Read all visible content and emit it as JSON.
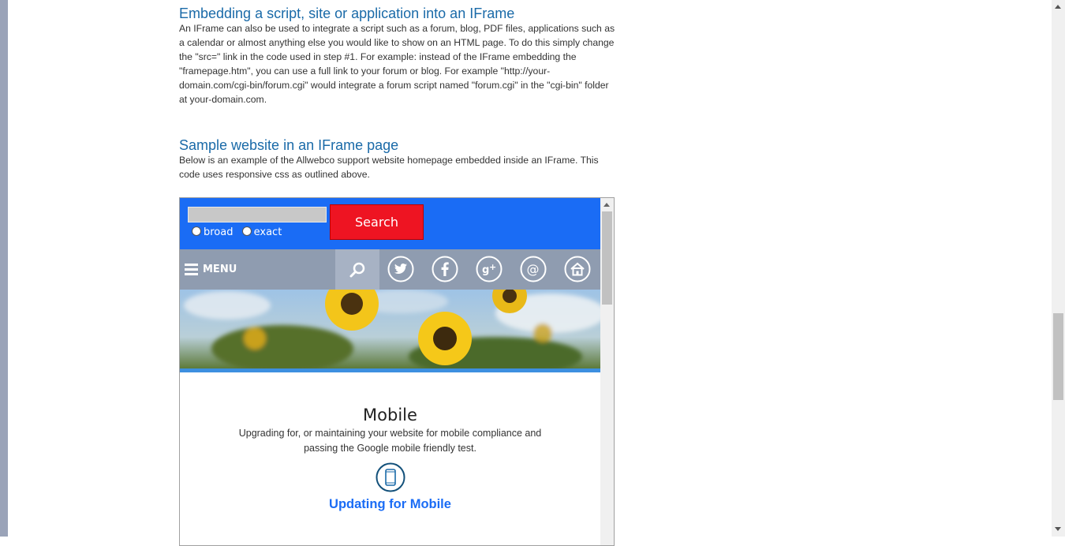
{
  "section1": {
    "heading": "Embedding a script, site or application into an IFrame",
    "text": "An IFrame can also be used to integrate a script such as a forum, blog, PDF files, applications such as a calendar or almost anything else you would like to show on an HTML page. To do this simply change the \"src=\" link in the code used in step #1. For example: instead of the IFrame embedding the \"framepage.htm\", you can use a full link to your forum or blog. For example \"http://your-domain.com/cgi-bin/forum.cgi\" would integrate a forum script named \"forum.cgi\" in the \"cgi-bin\" folder at your-domain.com."
  },
  "section2": {
    "heading": "Sample website in an IFrame page",
    "text": "Below is an example of the Allwebco support website homepage embedded inside an IFrame. This code uses responsive css as outlined above."
  },
  "iframe": {
    "search": {
      "input_value": "",
      "button_label": "Search",
      "options": [
        "broad",
        "exact"
      ]
    },
    "nav": {
      "menu_label": "MENU",
      "icons": [
        "search-icon",
        "twitter-icon",
        "facebook-icon",
        "google-plus-icon",
        "email-icon",
        "home-icon"
      ]
    },
    "feature": {
      "title": "Mobile",
      "description": "Upgrading for, or maintaining your website for mobile compliance and passing the Google mobile friendly test.",
      "link": "Updating for Mobile"
    }
  },
  "colors": {
    "heading": "#1a6aa8",
    "search_bar": "#1a6cf5",
    "search_button": "#ee1422",
    "nav_bar": "#8f9cb0",
    "link": "#1a6cf5"
  }
}
